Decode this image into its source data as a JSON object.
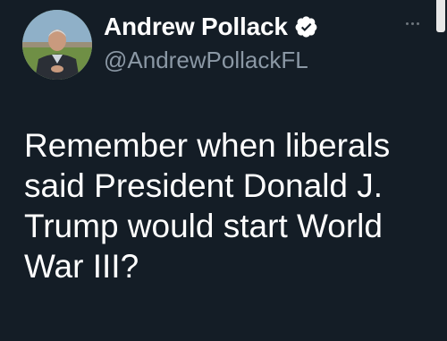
{
  "author": {
    "display_name": "Andrew Pollack",
    "handle": "@AndrewPollackFL",
    "verified": true,
    "avatar_icon": "profile-photo"
  },
  "tweet": {
    "text": "Remember when liberals\nsaid President Donald J.\nTrump would start World\nWar III?"
  },
  "menu": {
    "icon": "more-horizontal-icon"
  },
  "colors": {
    "background": "#141d26",
    "handle": "#8b98a5",
    "text": "#ffffff"
  }
}
